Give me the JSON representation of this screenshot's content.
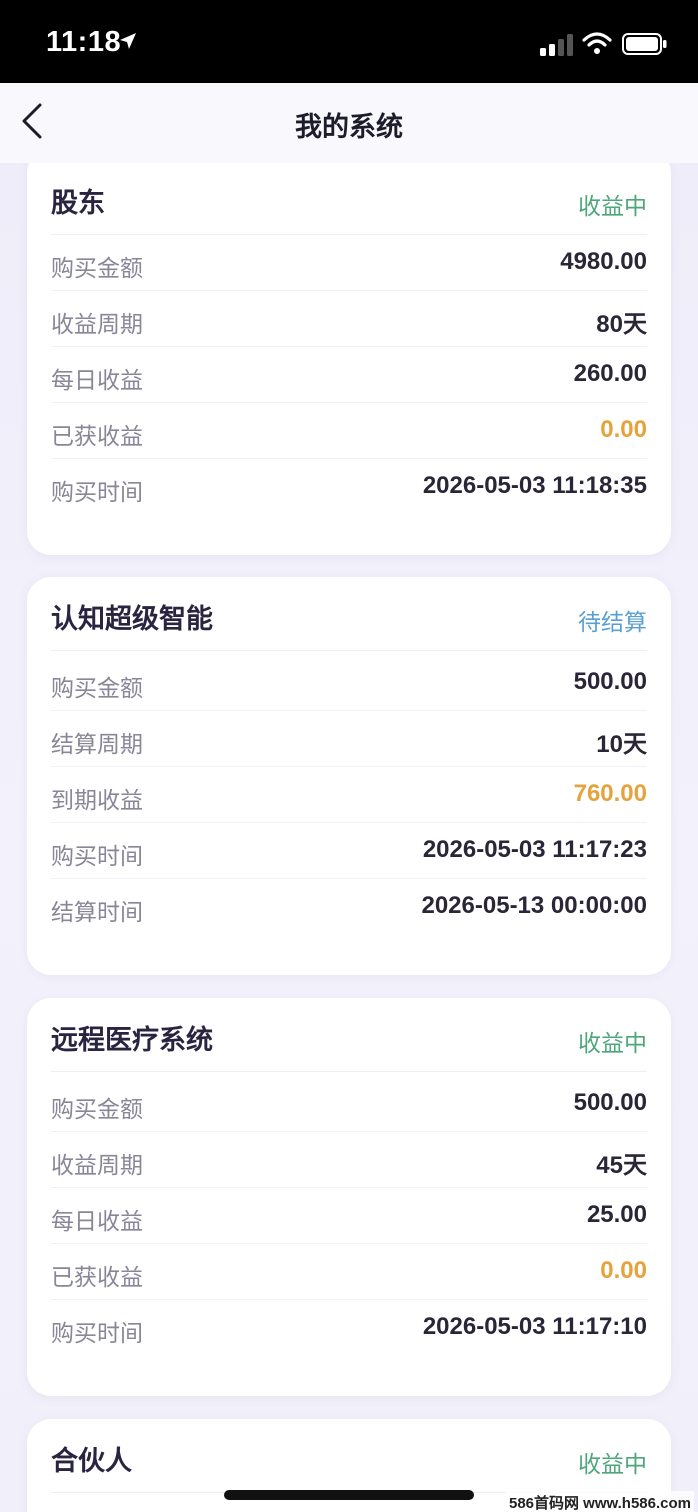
{
  "status_bar": {
    "time": "11:18",
    "icons": [
      "location-arrow-icon",
      "cellular-signal-icon",
      "wifi-icon",
      "battery-icon"
    ]
  },
  "nav": {
    "back_icon": "chevron-left-icon",
    "title": "我的系统"
  },
  "colors": {
    "status_earning": "#4ea77a",
    "status_pending": "#5b9fd1",
    "highlight_value": "#e6a23c",
    "text_primary": "#2a2638",
    "text_label": "#8a8698"
  },
  "cards": [
    {
      "title": "股东",
      "status": "收益中",
      "status_color": "#4ea77a",
      "rows": [
        {
          "label": "购买金额",
          "value": "4980.00"
        },
        {
          "label": "收益周期",
          "value": "80天"
        },
        {
          "label": "每日收益",
          "value": "260.00"
        },
        {
          "label": "已获收益",
          "value": "0.00",
          "highlight": true
        },
        {
          "label": "购买时间",
          "value": "2026-05-03 11:18:35"
        }
      ]
    },
    {
      "title": "认知超级智能",
      "status": "待结算",
      "status_color": "#5b9fd1",
      "rows": [
        {
          "label": "购买金额",
          "value": "500.00"
        },
        {
          "label": "结算周期",
          "value": "10天"
        },
        {
          "label": "到期收益",
          "value": "760.00",
          "highlight": true
        },
        {
          "label": "购买时间",
          "value": "2026-05-03 11:17:23"
        },
        {
          "label": "结算时间",
          "value": "2026-05-13 00:00:00"
        }
      ]
    },
    {
      "title": "远程医疗系统",
      "status": "收益中",
      "status_color": "#4ea77a",
      "rows": [
        {
          "label": "购买金额",
          "value": "500.00"
        },
        {
          "label": "收益周期",
          "value": "45天"
        },
        {
          "label": "每日收益",
          "value": "25.00"
        },
        {
          "label": "已获收益",
          "value": "0.00",
          "highlight": true
        },
        {
          "label": "购买时间",
          "value": "2026-05-03 11:17:10"
        }
      ]
    },
    {
      "title": "合伙人",
      "status": "收益中",
      "status_color": "#4ea77a",
      "rows": []
    }
  ],
  "watermark": "586首码网 www.h586.com"
}
